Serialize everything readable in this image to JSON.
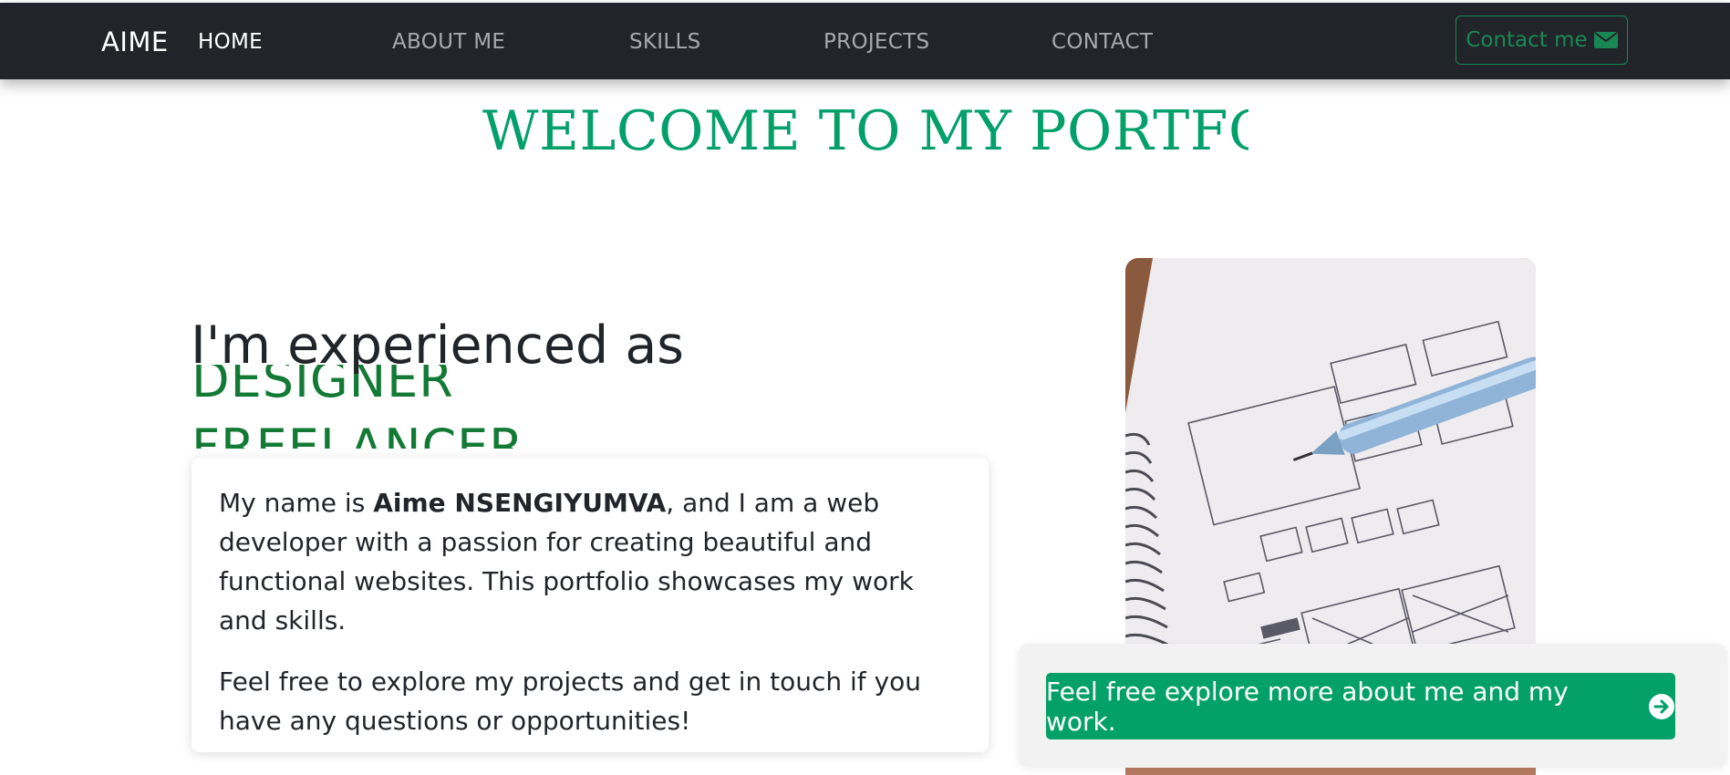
{
  "nav": {
    "brand": "AIME",
    "links": [
      {
        "label": "HOME"
      },
      {
        "label": "ABOUT ME"
      },
      {
        "label": "SKILLS"
      },
      {
        "label": "PROJECTS"
      },
      {
        "label": "CONTACT"
      }
    ],
    "contact_button": {
      "label": "Contact me",
      "icon": "envelope-icon"
    }
  },
  "welcome": {
    "title": "WELCOME TO MY PORTFOLIO"
  },
  "hero": {
    "heading": "I'm experienced as",
    "roles": [
      "DESIGNER",
      "FREELANCER"
    ]
  },
  "intro": {
    "p1_prefix": "My name is ",
    "p1_name": "Aime NSENGIYUMVA",
    "p1_suffix": ", and I am a web developer with a passion for creating beautiful and functional websites. This portfolio showcases my work and skills.",
    "p2": "Feel free to explore my projects and get in touch if you have any questions or opportunities!"
  },
  "explore": {
    "label": "Feel free explore more about me and my work.",
    "icon": "arrow-right-circle-icon"
  },
  "colors": {
    "navbar": "#212529",
    "accent_green": "#04a06a",
    "role_green": "#137a35",
    "outline_green": "#198754"
  }
}
